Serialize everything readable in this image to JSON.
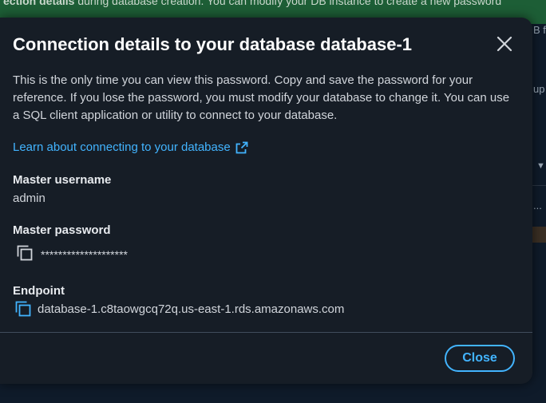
{
  "background": {
    "banner_bold": "ection details",
    "banner_text": " during database creation. You can modify your DB instance to create a new password",
    "side_fragments": {
      "b_f": "B f",
      "up": "up",
      "dropdown": "▼",
      "dots": "..."
    }
  },
  "modal": {
    "title": "Connection details to your database database-1",
    "description": "This is the only time you can view this password. Copy and save the password for your reference. If you lose the password, you must modify your database to change it. You can use a SQL client application or utility to connect to your database.",
    "learn_link": "Learn about connecting to your database",
    "master_username": {
      "label": "Master username",
      "value": "admin"
    },
    "master_password": {
      "label": "Master password",
      "value": "********************"
    },
    "endpoint": {
      "label": "Endpoint",
      "value": "database-1.c8taowgcq72q.us-east-1.rds.amazonaws.com"
    },
    "close_button": "Close"
  },
  "colors": {
    "accent": "#42b4ff",
    "modal_bg": "#161d26",
    "banner_bg": "#1d5e36"
  },
  "icons": [
    "close-icon",
    "external-link-icon",
    "copy-icon"
  ]
}
